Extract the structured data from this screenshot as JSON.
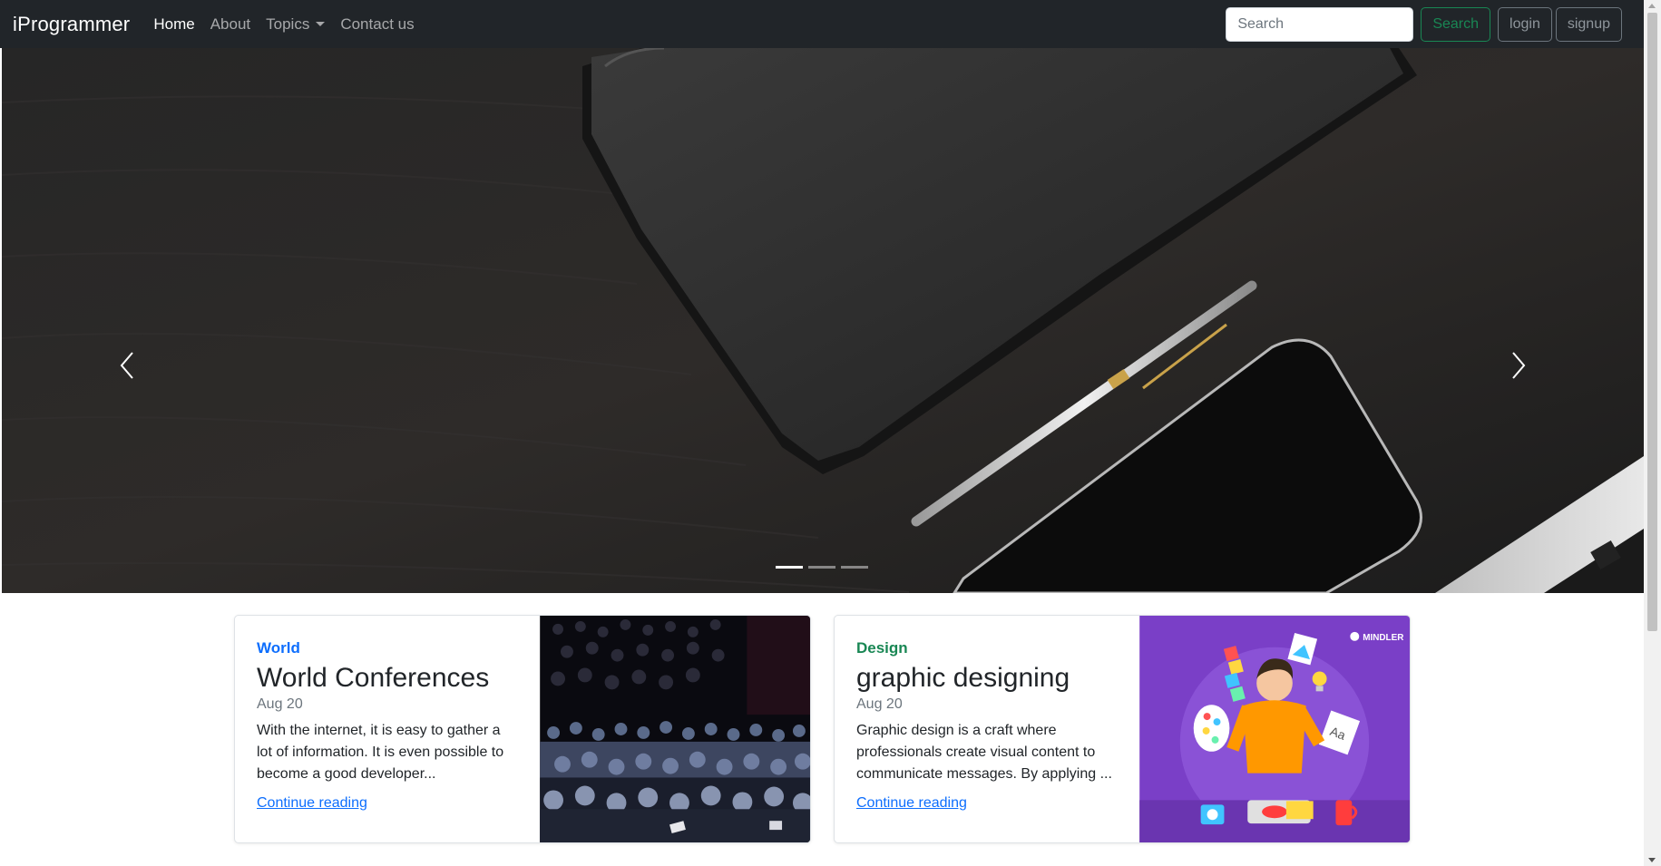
{
  "navbar": {
    "brand": "iProgrammer",
    "links": [
      {
        "label": "Home",
        "active": true
      },
      {
        "label": "About",
        "active": false
      },
      {
        "label": "Topics",
        "active": false,
        "dropdown": true
      },
      {
        "label": "Contact us",
        "active": false
      }
    ],
    "search_placeholder": "Search",
    "search_button": "Search",
    "login_button": "login",
    "signup_button": "signup"
  },
  "carousel": {
    "slide_count": 3,
    "active_slide": 1,
    "icons": {
      "prev": "chevron-left-icon",
      "next": "chevron-right-icon"
    }
  },
  "cards": [
    {
      "category": "World",
      "category_color": "#0d6efd",
      "title": "World Conferences",
      "date": "Aug 20",
      "text": "With the internet, it is easy to gather a lot of information. It is even possible to become a good developer...",
      "link": "Continue reading"
    },
    {
      "category": "Design",
      "category_color": "#198754",
      "title": "graphic designing",
      "date": "Aug 20",
      "text": "Graphic design is a craft where professionals create visual content to communicate messages. By applying ...",
      "link": "Continue reading",
      "image_logo": "MINDLER"
    }
  ],
  "colors": {
    "navbar_bg": "#212529",
    "success": "#198754",
    "secondary": "#6c757d",
    "link": "#0d6efd"
  }
}
